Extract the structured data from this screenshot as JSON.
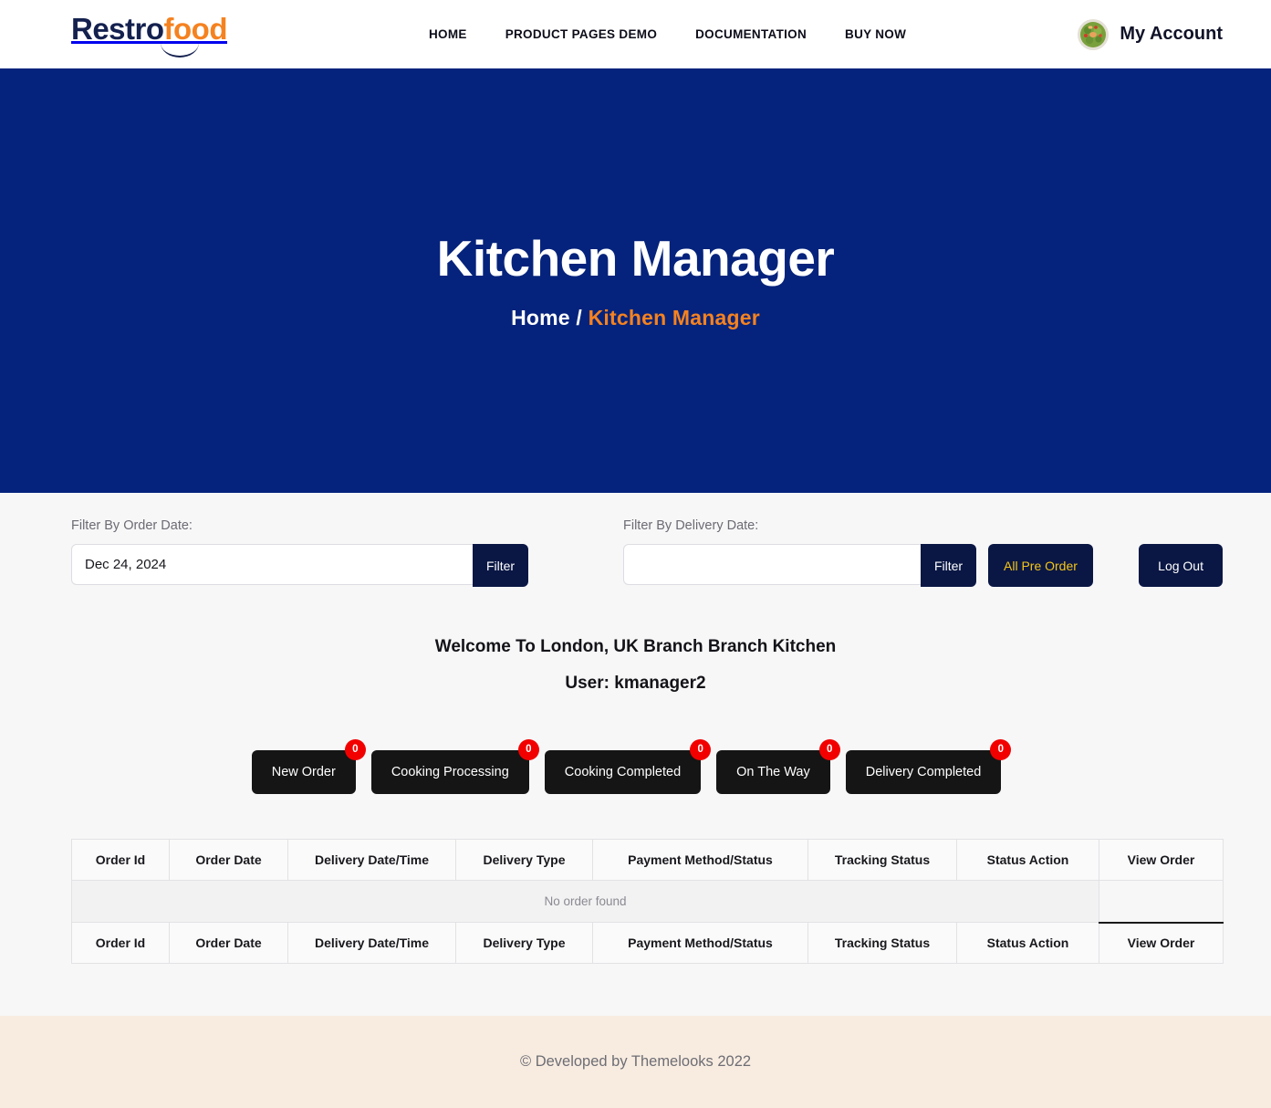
{
  "header": {
    "logo": {
      "part1": "Restro",
      "part2": "food"
    },
    "nav": [
      {
        "label": "HOME"
      },
      {
        "label": "PRODUCT PAGES DEMO"
      },
      {
        "label": "DOCUMENTATION"
      },
      {
        "label": "BUY NOW"
      }
    ],
    "account": {
      "label": "My Account",
      "avatar_icon": "food-bowl-avatar"
    }
  },
  "hero": {
    "title": "Kitchen Manager",
    "breadcrumb_home": "Home",
    "breadcrumb_separator": "/",
    "breadcrumb_current": "Kitchen Manager"
  },
  "filters": {
    "order_date_label": "Filter By Order Date:",
    "order_date_value": "Dec 24, 2024",
    "order_date_placeholder": "",
    "order_filter_button": "Filter",
    "delivery_date_label": "Filter By Delivery Date:",
    "delivery_date_value": "",
    "delivery_date_placeholder": "",
    "delivery_filter_button": "Filter",
    "all_pre_order_button": "All Pre Order",
    "logout_button": "Log Out"
  },
  "welcome": {
    "branch_line": "Welcome To London, UK Branch Branch Kitchen",
    "user_line": "User: kmanager2"
  },
  "status_buttons": [
    {
      "label": "New Order",
      "count": "0"
    },
    {
      "label": "Cooking Processing",
      "count": "0"
    },
    {
      "label": "Cooking Completed",
      "count": "0"
    },
    {
      "label": "On The Way",
      "count": "0"
    },
    {
      "label": "Delivery Completed",
      "count": "0"
    }
  ],
  "table": {
    "columns": [
      "Order Id",
      "Order Date",
      "Delivery Date/Time",
      "Delivery Type",
      "Payment Method/Status",
      "Tracking Status",
      "Status Action",
      "View Order"
    ],
    "empty_message": "No order found",
    "rows": []
  },
  "footer": {
    "text": "© Developed by Themelooks 2022"
  },
  "colors": {
    "banner_navy": "#05237c",
    "button_navy": "#0a1744",
    "accent_orange": "#f58220",
    "badge_red": "#f20000",
    "preorder_yellow": "#f5c518",
    "status_black": "#151515",
    "footer_cream": "#f8ece0"
  }
}
